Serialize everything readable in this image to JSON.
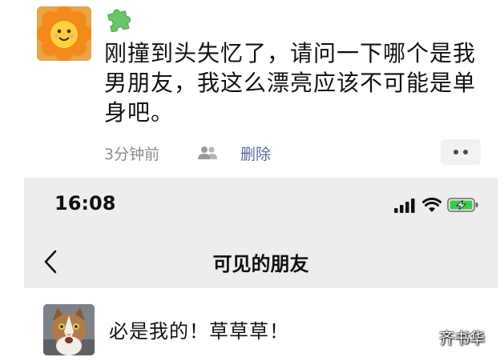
{
  "post": {
    "text": "刚撞到头失忆了，请问一下哪个是我男朋友，我这么漂亮应该不可能是单身吧。",
    "time": "3分钟前",
    "delete_label": "删除",
    "icons": {
      "avatar": "sunflower-avatar",
      "badge": "puzzle-icon",
      "visibility": "people-icon",
      "more": "more-dots-icon"
    },
    "link_color": "#576b95"
  },
  "phone": {
    "status_time": "16:08",
    "nav_title": "可见的朋友",
    "back_icon": "chevron-left-icon",
    "friend": {
      "avatar": "cat-avatar",
      "comment": "必是我的！草草草！"
    }
  },
  "watermark": "齐书华"
}
